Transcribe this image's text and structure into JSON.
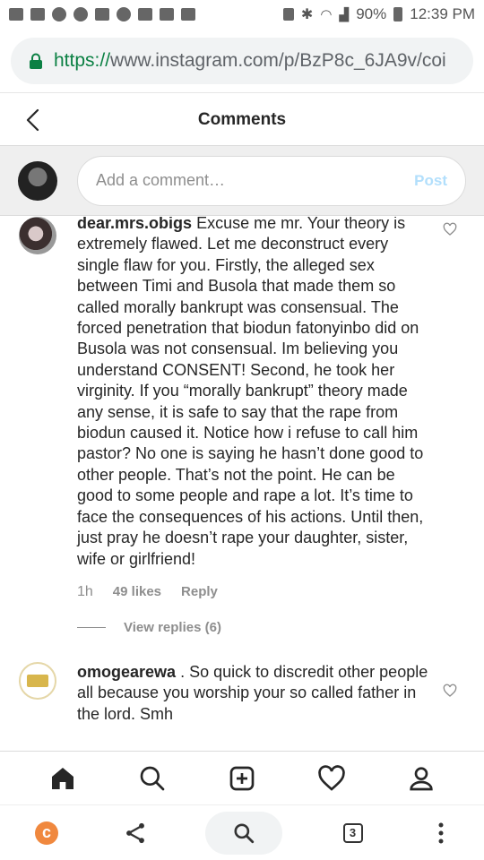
{
  "status_bar": {
    "battery": "90%",
    "time": "12:39 PM"
  },
  "browser": {
    "url_scheme": "https://",
    "url_rest": "www.instagram.com/p/BzP8c_6JA9v/coi",
    "tab_count": "3"
  },
  "header": {
    "title": "Comments"
  },
  "add_comment": {
    "placeholder": "Add a comment…",
    "post_label": "Post"
  },
  "comments": [
    {
      "username": "dear.mrs.obigs",
      "text": "Excuse me mr. Your theory is extremely flawed. Let me deconstruct every single flaw for you. Firstly, the alleged sex between Timi and Busola that made them so called morally bankrupt was consensual. The forced penetration that biodun fatonyinbo did on Busola was not consensual. Im believing you understand CONSENT! Second, he took her virginity. If you “morally bankrupt” theory made any sense, it is safe to say that the rape from biodun caused it. Notice how i refuse to call him pastor? No one is saying he hasn’t done good to other people. That’s not the point. He can be good to some people and rape a lot. It’s time to face the consequences of his actions. Until then, just pray he doesn’t rape your daughter, sister, wife or girlfriend!",
      "time": "1h",
      "likes": "49 likes",
      "reply": "Reply",
      "view_replies": "View replies (6)"
    },
    {
      "username": "omogearewa",
      "text": ". So quick to discredit other people all because you worship your so called father in the lord. Smh"
    }
  ]
}
